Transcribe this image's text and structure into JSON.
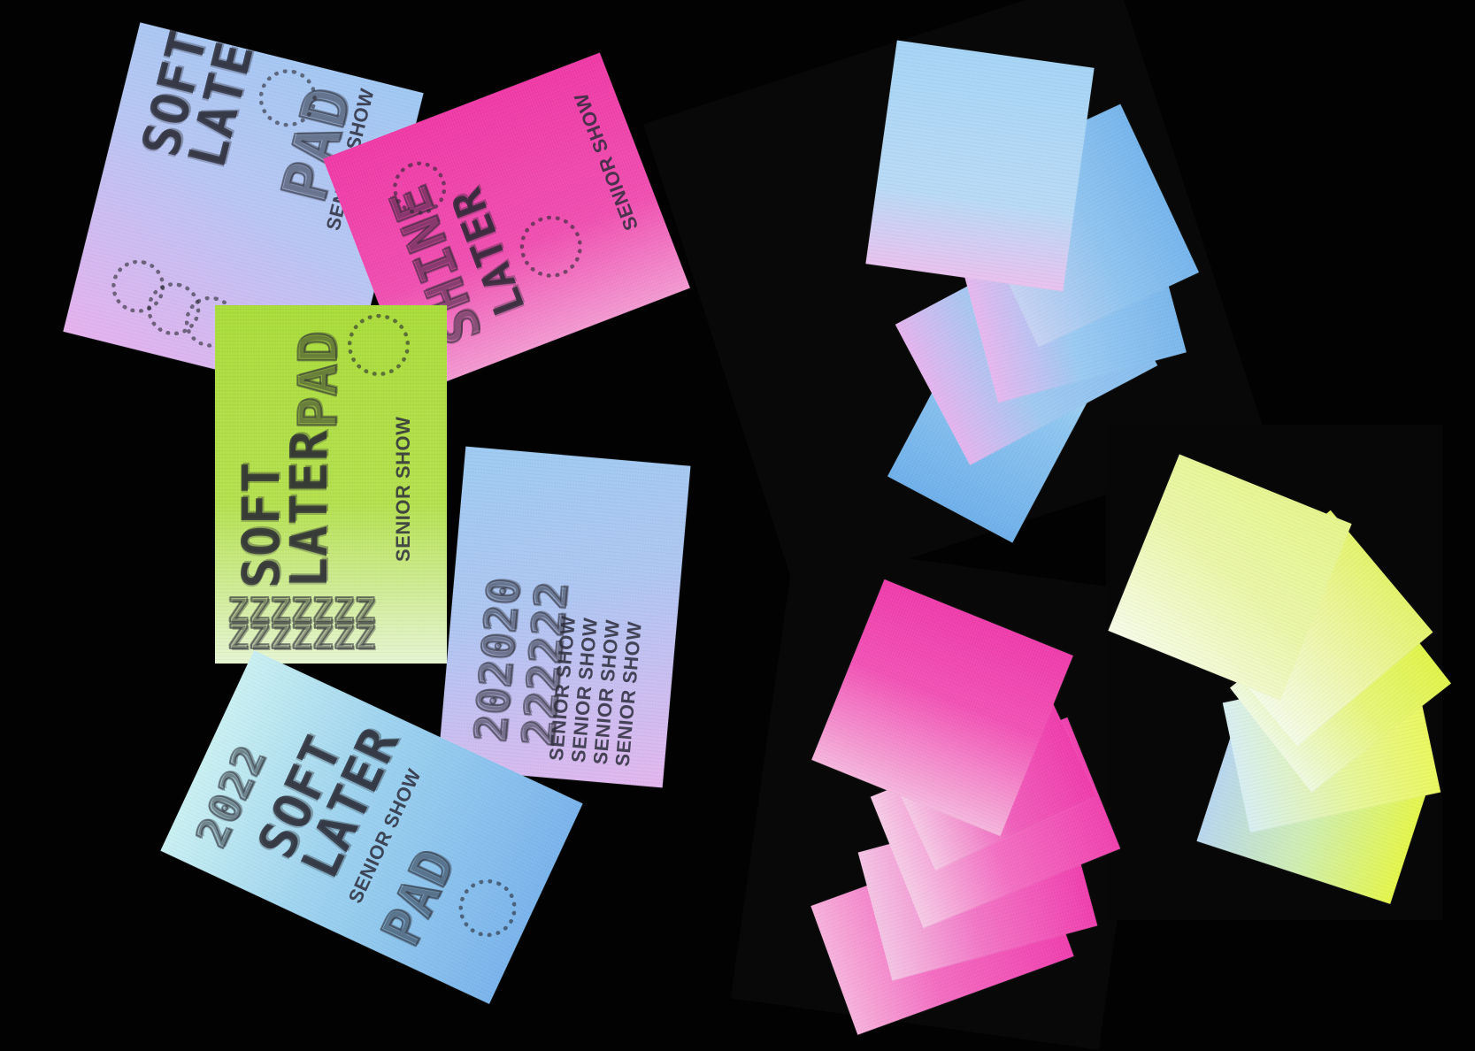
{
  "cards_text": {
    "senior_show": "SENIOR SHOW"
  }
}
